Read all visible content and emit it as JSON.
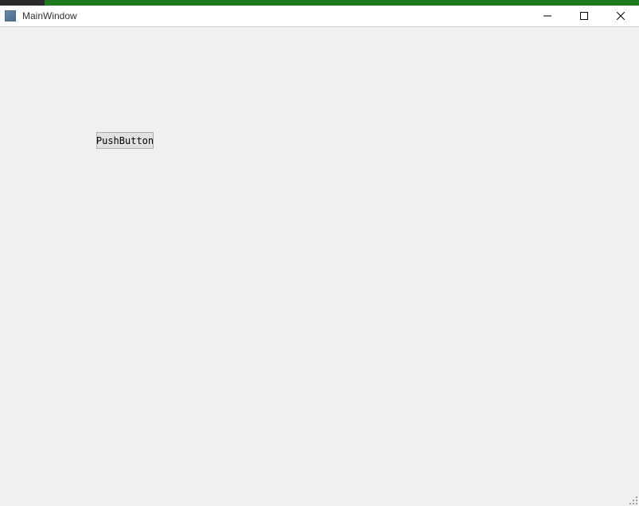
{
  "window": {
    "title": "MainWindow"
  },
  "main": {
    "push_button_label": "PushButton"
  }
}
